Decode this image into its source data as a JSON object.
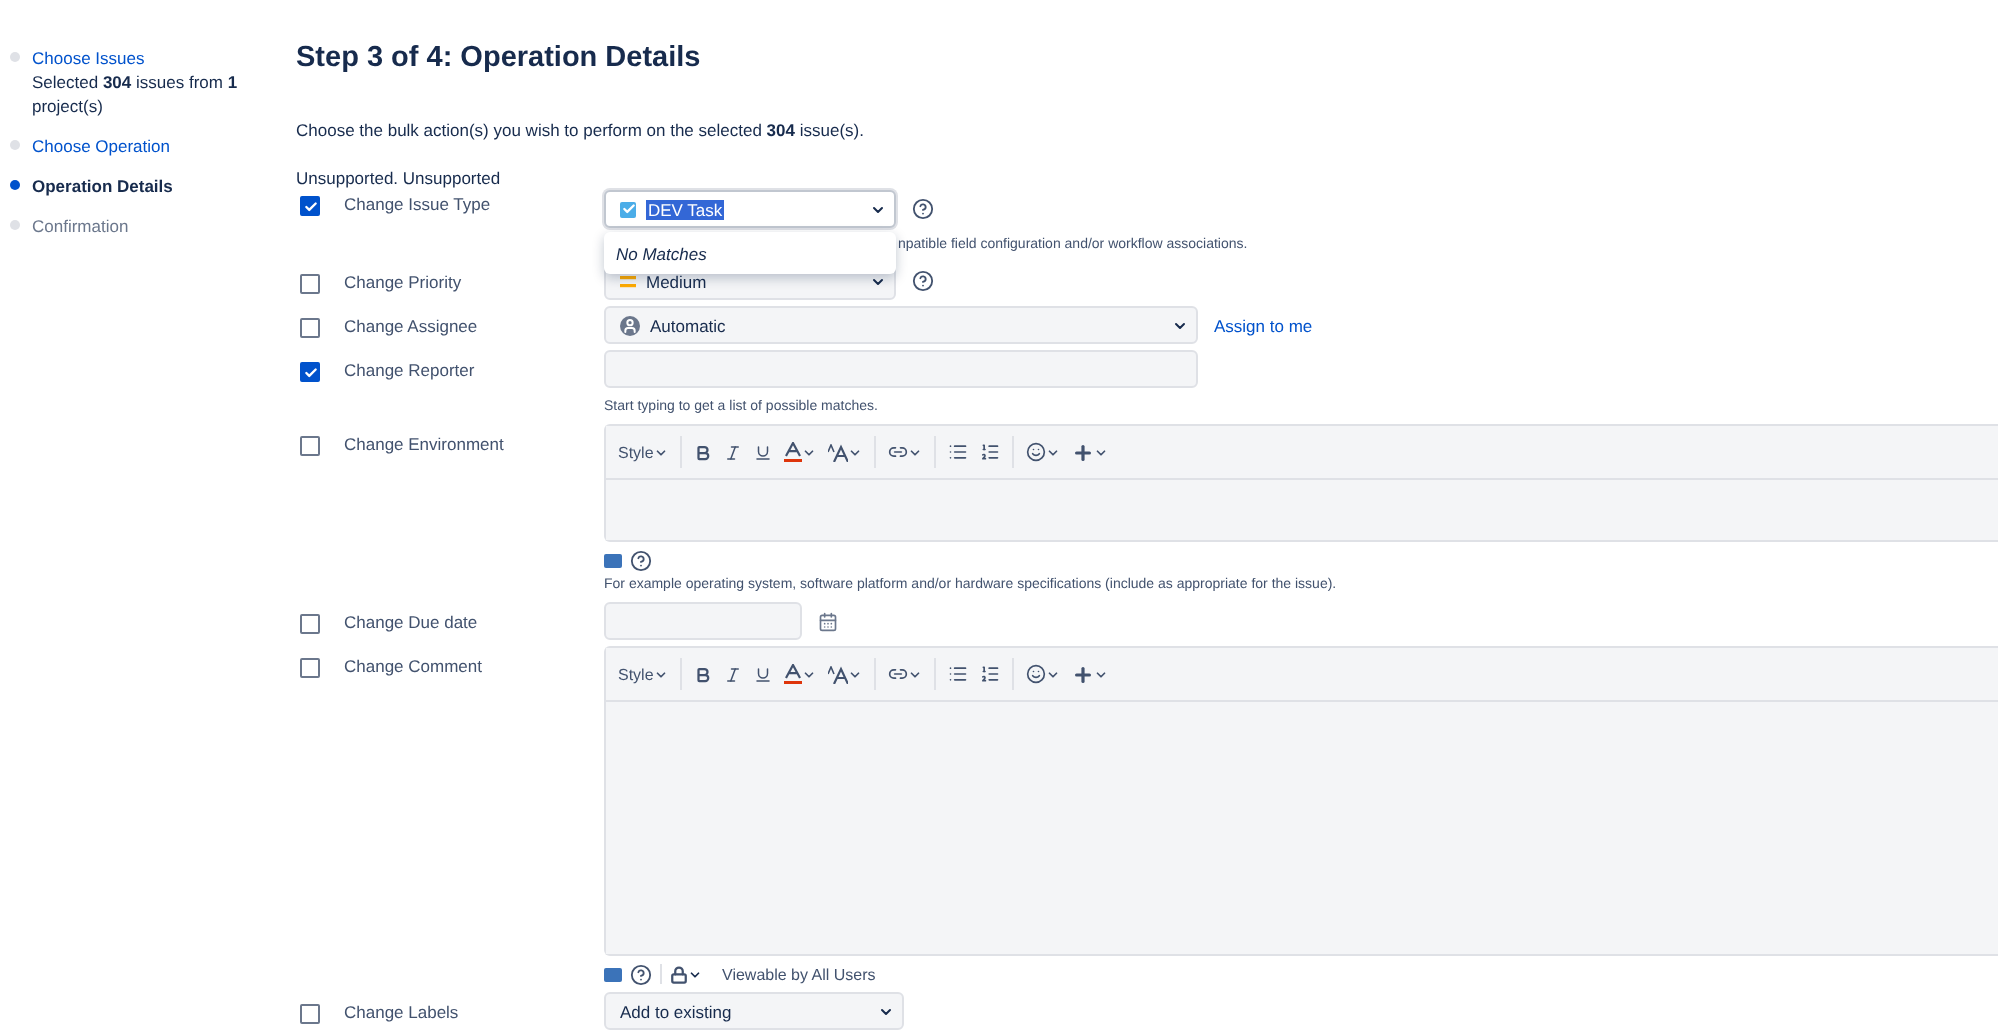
{
  "sidebar": {
    "steps": [
      {
        "label": "Choose Issues",
        "selected": false,
        "link": true,
        "detail": "Selected **304** issues from **1** project(s)"
      },
      {
        "label": "Choose Operation",
        "selected": false,
        "link": true
      },
      {
        "label": "Operation Details",
        "selected": true,
        "link": false
      },
      {
        "label": "Confirmation",
        "selected": false,
        "link": false
      }
    ]
  },
  "title": "Step 3 of 4: Operation Details",
  "intro": "Choose the bulk action(s) you wish to perform on the selected **304** issue(s).",
  "note": "Unsupported. Unsupported",
  "operations": [
    {
      "label": "Change Issue Type",
      "checked": true,
      "kind": "select",
      "value": "DEV Task",
      "highlighted": true,
      "help": true,
      "dropdown": {
        "message": "No Matches"
      },
      "hint": "npatible field configuration and/or workflow associations."
    },
    {
      "label": "Change Priority",
      "checked": false,
      "kind": "priority-select",
      "value": "Medium",
      "help": true
    },
    {
      "label": "Change Assignee",
      "checked": false,
      "kind": "user-select",
      "value": "Automatic",
      "link": "Assign to me"
    },
    {
      "label": "Change Reporter",
      "checked": true,
      "kind": "text",
      "hint": "Start typing to get a list of possible matches."
    },
    {
      "label": "Change Environment",
      "checked": false,
      "kind": "editor",
      "style_label": "Style",
      "hint": "For example operating system, software platform and/or hardware specifications (include as appropriate for the issue)."
    },
    {
      "label": "Change Due date",
      "checked": false,
      "kind": "date"
    },
    {
      "label": "Change Comment",
      "checked": false,
      "kind": "comment-editor",
      "style_label": "Style",
      "visibility": "Viewable by All Users"
    },
    {
      "label": "Change Labels",
      "checked": false,
      "kind": "plain-select",
      "value": "Add to existing"
    }
  ]
}
